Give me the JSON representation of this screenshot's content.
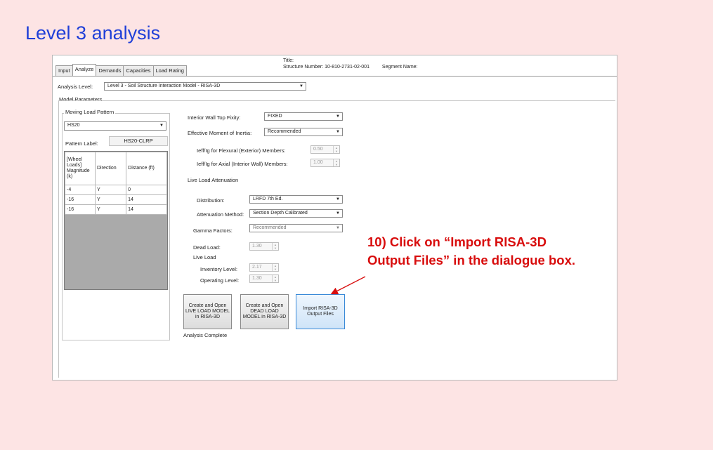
{
  "slide": {
    "title": "Level 3 analysis",
    "callout_line1": "10) Click on “Import RISA-3D",
    "callout_line2": "Output Files” in the dialogue box."
  },
  "window": {
    "title_label": "Title:",
    "structure_number_label": "Structure Number: 10-810-2731-02-001",
    "segment_name_label": "Segment Name:"
  },
  "tabs": [
    {
      "label": "Input"
    },
    {
      "label": "Analyze"
    },
    {
      "label": "Demands"
    },
    {
      "label": "Capacities"
    },
    {
      "label": "Load Rating"
    }
  ],
  "analysis_level": {
    "label": "Analysis Level:",
    "value": "Level 3 - Soil Structure Interaction Model - RISA-3D"
  },
  "model_parameters": {
    "title": "Model Parameters",
    "moving_load_pattern": {
      "title": "Moving Load Pattern",
      "selected": "HS20",
      "pattern_label_label": "Pattern Label:",
      "pattern_label_value": "HS20-CLRP",
      "table": {
        "headers": [
          "[Wheel Loads] Magnitude (k)",
          "Direction",
          "Distance (ft)"
        ],
        "rows": [
          [
            "-4",
            "Y",
            "0"
          ],
          [
            "-16",
            "Y",
            "14"
          ],
          [
            "-16",
            "Y",
            "14"
          ]
        ]
      }
    },
    "interior_wall_top_fixity": {
      "label": "Interior Wall Top Fixity:",
      "value": "FIXED"
    },
    "effective_moment": {
      "label": "Effective Moment of Inertia:",
      "value": "Recommended"
    },
    "ieff_flexural": {
      "label": "Ieff/Ig for Flexural (Exterior) Members:",
      "value": "0.50"
    },
    "ieff_axial": {
      "label": "Ieff/Ig for Axial (Interior Wall) Members:",
      "value": "1.00"
    },
    "live_load_attenuation_label": "Live Load Attenuation",
    "distribution": {
      "label": "Distribution:",
      "value": "LRFD 7th Ed."
    },
    "attenuation_method": {
      "label": "Attenuation Method:",
      "value": "Section Depth Calibrated"
    },
    "gamma_factors": {
      "label": "Gamma Factors:",
      "value": "Recommended"
    },
    "dead_load": {
      "label": "Dead Load:",
      "value": "1.30"
    },
    "live_load_label": "Live Load",
    "inventory_level": {
      "label": "Inventory Level:",
      "value": "2.17"
    },
    "operating_level": {
      "label": "Operating Level:",
      "value": "1.30"
    }
  },
  "buttons": {
    "live_load_model": "Create and Open LIVE LOAD MODEL in RISA-3D",
    "dead_load_model": "Create and Open DEAD LOAD MODEL in RISA-3D",
    "import_output": "Import RISA-3D Output Files"
  },
  "status": "Analysis Complete",
  "colors": {
    "slide_background": "#fde4e4",
    "title_blue": "#1f3fd8",
    "callout_red": "#d80d0d",
    "button_highlight": "#3a8ad8"
  }
}
